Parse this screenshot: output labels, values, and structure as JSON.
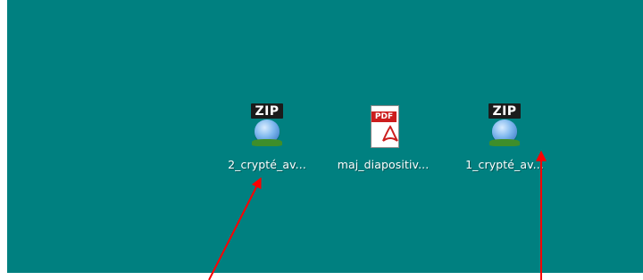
{
  "desktop": {
    "background_color": "#008080",
    "icons": [
      {
        "label": "2_crypté_av...",
        "type": "zip",
        "badge_text": "ZIP",
        "icon_name": "zip-archive-icon"
      },
      {
        "label": "maj_diapositiv...",
        "type": "pdf",
        "badge_text": "PDF",
        "icon_name": "pdf-document-icon"
      },
      {
        "label": "1_crypté_av...",
        "type": "zip",
        "badge_text": "ZIP",
        "icon_name": "zip-archive-icon"
      }
    ]
  },
  "annotations": {
    "arrow_color": "#ff0000"
  }
}
